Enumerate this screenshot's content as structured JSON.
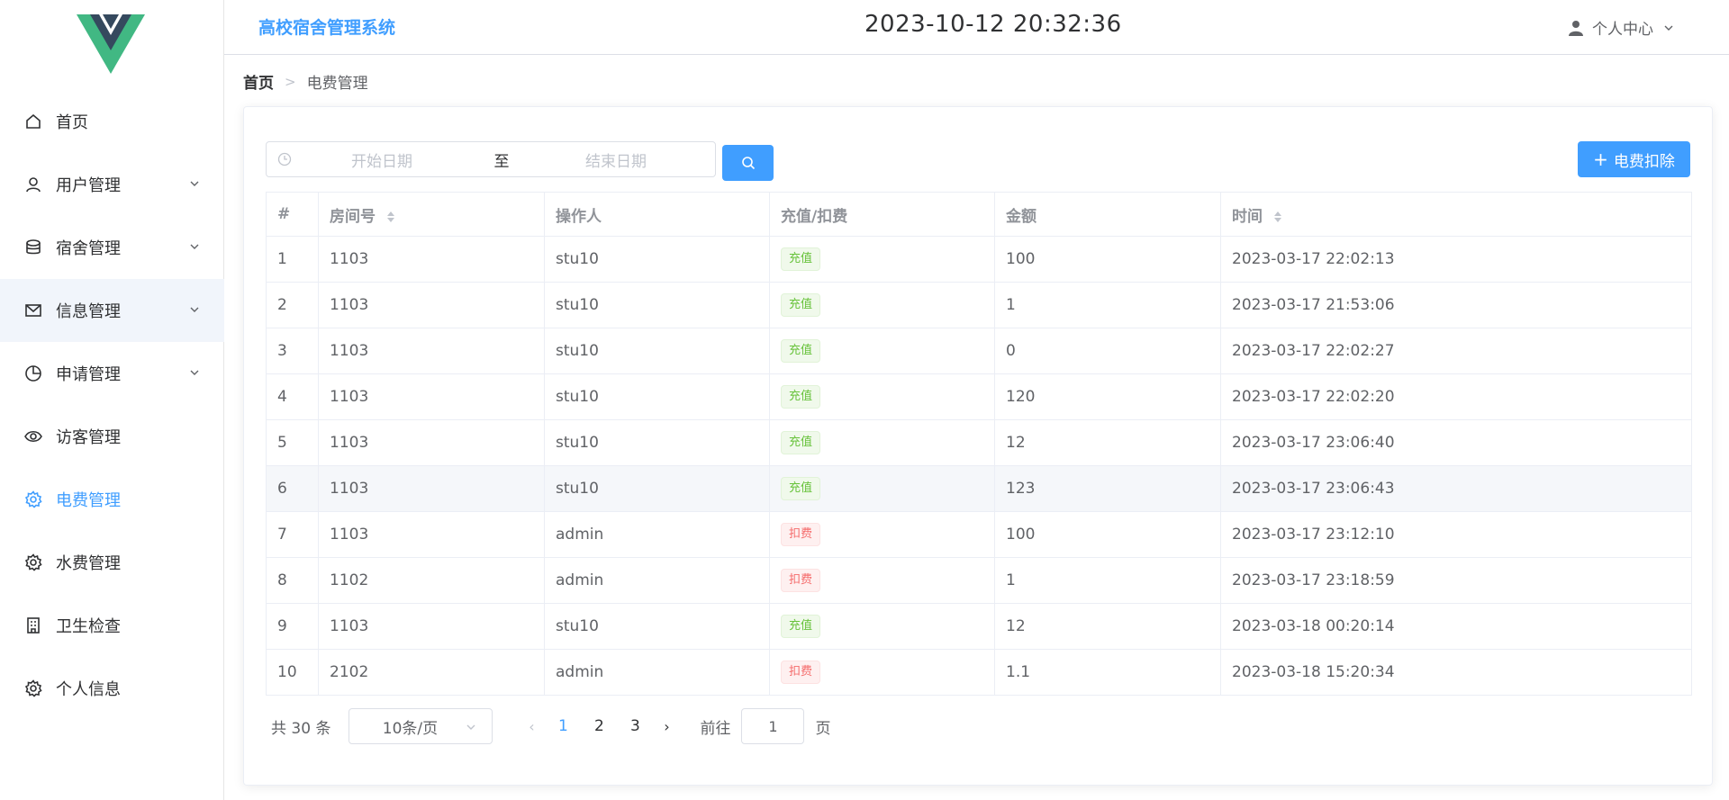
{
  "header": {
    "app_title": "高校宿舍管理系统",
    "datetime": "2023-10-12 20:32:36",
    "user_menu_label": "个人中心"
  },
  "sidebar": {
    "items": [
      {
        "label": "首页",
        "icon": "home-icon",
        "has_submenu": false
      },
      {
        "label": "用户管理",
        "icon": "user-icon",
        "has_submenu": true
      },
      {
        "label": "宿舍管理",
        "icon": "database-icon",
        "has_submenu": true
      },
      {
        "label": "信息管理",
        "icon": "mail-icon",
        "has_submenu": true
      },
      {
        "label": "申请管理",
        "icon": "pie-chart-icon",
        "has_submenu": true
      },
      {
        "label": "访客管理",
        "icon": "eye-icon",
        "has_submenu": false
      },
      {
        "label": "电费管理",
        "icon": "gear-icon",
        "has_submenu": false,
        "active": true
      },
      {
        "label": "水费管理",
        "icon": "gear-icon",
        "has_submenu": false
      },
      {
        "label": "卫生检查",
        "icon": "building-icon",
        "has_submenu": false
      },
      {
        "label": "个人信息",
        "icon": "gear-icon",
        "has_submenu": false
      }
    ]
  },
  "breadcrumb": {
    "home": "首页",
    "separator": ">",
    "current": "电费管理"
  },
  "toolbar": {
    "start_placeholder": "开始日期",
    "range_separator": "至",
    "end_placeholder": "结束日期",
    "add_label": "电费扣除"
  },
  "table": {
    "headers": [
      "#",
      "房间号",
      "操作人",
      "充值/扣费",
      "金额",
      "时间"
    ],
    "rows": [
      {
        "idx": "1",
        "room": "1103",
        "operator": "stu10",
        "type": "充值",
        "kind": "success",
        "amount": "100",
        "time": "2023-03-17 22:02:13"
      },
      {
        "idx": "2",
        "room": "1103",
        "operator": "stu10",
        "type": "充值",
        "kind": "success",
        "amount": "1",
        "time": "2023-03-17 21:53:06"
      },
      {
        "idx": "3",
        "room": "1103",
        "operator": "stu10",
        "type": "充值",
        "kind": "success",
        "amount": "0",
        "time": "2023-03-17 22:02:27"
      },
      {
        "idx": "4",
        "room": "1103",
        "operator": "stu10",
        "type": "充值",
        "kind": "success",
        "amount": "120",
        "time": "2023-03-17 22:02:20"
      },
      {
        "idx": "5",
        "room": "1103",
        "operator": "stu10",
        "type": "充值",
        "kind": "success",
        "amount": "12",
        "time": "2023-03-17 23:06:40"
      },
      {
        "idx": "6",
        "room": "1103",
        "operator": "stu10",
        "type": "充值",
        "kind": "success",
        "amount": "123",
        "time": "2023-03-17 23:06:43"
      },
      {
        "idx": "7",
        "room": "1103",
        "operator": "admin",
        "type": "扣费",
        "kind": "danger",
        "amount": "100",
        "time": "2023-03-17 23:12:10"
      },
      {
        "idx": "8",
        "room": "1102",
        "operator": "admin",
        "type": "扣费",
        "kind": "danger",
        "amount": "1",
        "time": "2023-03-17 23:18:59"
      },
      {
        "idx": "9",
        "room": "1103",
        "operator": "stu10",
        "type": "充值",
        "kind": "success",
        "amount": "12",
        "time": "2023-03-18 00:20:14"
      },
      {
        "idx": "10",
        "room": "2102",
        "operator": "admin",
        "type": "扣费",
        "kind": "danger",
        "amount": "1.1",
        "time": "2023-03-18 15:20:34"
      }
    ]
  },
  "pagination": {
    "total": "共 30 条",
    "page_size": "10条/页",
    "pages": [
      "1",
      "2",
      "3"
    ],
    "current_page": "1",
    "goto_label": "前往",
    "goto_value": "1",
    "page_suffix": "页"
  },
  "colors": {
    "primary": "#409eff",
    "success": "#67c23a",
    "danger": "#f56c6c"
  }
}
